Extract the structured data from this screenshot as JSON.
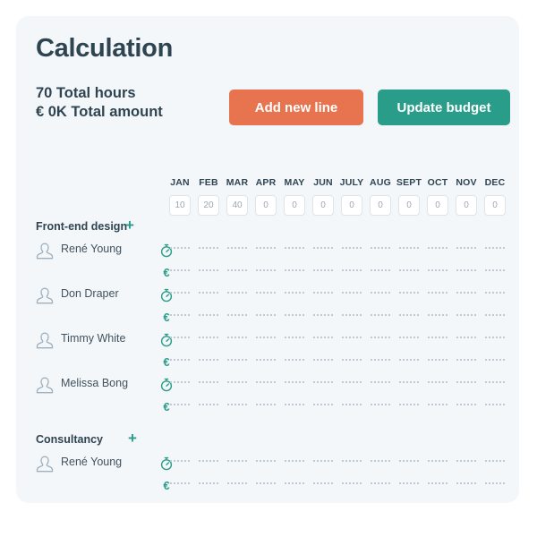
{
  "card": {
    "title": "Calculation",
    "total_hours_line": "70 Total hours",
    "total_amount_line": "€ 0K Total amount"
  },
  "actions": {
    "add_new_line": "Add new line",
    "update_budget": "Update budget",
    "add_new_line_color": "#e8734f",
    "update_budget_color": "#2a9d8a"
  },
  "budget_row": {
    "months": [
      "JAN",
      "FEB",
      "MAR",
      "APR",
      "MAY",
      "JUN",
      "JULY",
      "AUG",
      "SEPT",
      "OCT",
      "NOV",
      "DEC"
    ],
    "values": [
      "10",
      "20",
      "40",
      "0",
      "0",
      "0",
      "0",
      "0",
      "0",
      "0",
      "0",
      "0"
    ]
  },
  "groups": [
    {
      "name": "Front-end design",
      "add_label": "+",
      "members": [
        {
          "name": "René Young",
          "avatar_icon": "person-icon",
          "hours_icon": "stopwatch-icon",
          "money_icon": "€",
          "hours_cells": [
            "",
            "",
            "",
            "",
            "",
            "",
            "",
            "",
            "",
            "",
            "",
            ""
          ],
          "money_cells": [
            "",
            "",
            "",
            "",
            "",
            "",
            "",
            "",
            "",
            "",
            "",
            ""
          ]
        },
        {
          "name": "Don Draper",
          "avatar_icon": "person-icon",
          "hours_icon": "stopwatch-icon",
          "money_icon": "€",
          "hours_cells": [
            "",
            "",
            "",
            "",
            "",
            "",
            "",
            "",
            "",
            "",
            "",
            ""
          ],
          "money_cells": [
            "",
            "",
            "",
            "",
            "",
            "",
            "",
            "",
            "",
            "",
            "",
            ""
          ]
        },
        {
          "name": "Timmy White",
          "avatar_icon": "person-icon",
          "hours_icon": "stopwatch-icon",
          "money_icon": "€",
          "hours_cells": [
            "",
            "",
            "",
            "",
            "",
            "",
            "",
            "",
            "",
            "",
            "",
            ""
          ],
          "money_cells": [
            "",
            "",
            "",
            "",
            "",
            "",
            "",
            "",
            "",
            "",
            "",
            ""
          ]
        },
        {
          "name": "Melissa Bong",
          "avatar_icon": "person-icon",
          "hours_icon": "stopwatch-icon",
          "money_icon": "€",
          "hours_cells": [
            "",
            "",
            "",
            "",
            "",
            "",
            "",
            "",
            "",
            "",
            "",
            ""
          ],
          "money_cells": [
            "",
            "",
            "",
            "",
            "",
            "",
            "",
            "",
            "",
            "",
            "",
            ""
          ]
        }
      ]
    },
    {
      "name": "Consultancy",
      "add_label": "+",
      "members": [
        {
          "name": "René Young",
          "avatar_icon": "person-icon",
          "hours_icon": "stopwatch-icon",
          "money_icon": "€",
          "hours_cells": [
            "",
            "",
            "",
            "",
            "",
            "",
            "",
            "",
            "",
            "",
            "",
            ""
          ],
          "money_cells": [
            "",
            "",
            "",
            "",
            "",
            "",
            "",
            "",
            "",
            "",
            "",
            ""
          ]
        }
      ]
    }
  ],
  "theme": {
    "card_background": "#f4f7fa",
    "text_dark": "#2e4450",
    "accent_teal": "#2a9d8a",
    "accent_orange": "#e8734f"
  }
}
